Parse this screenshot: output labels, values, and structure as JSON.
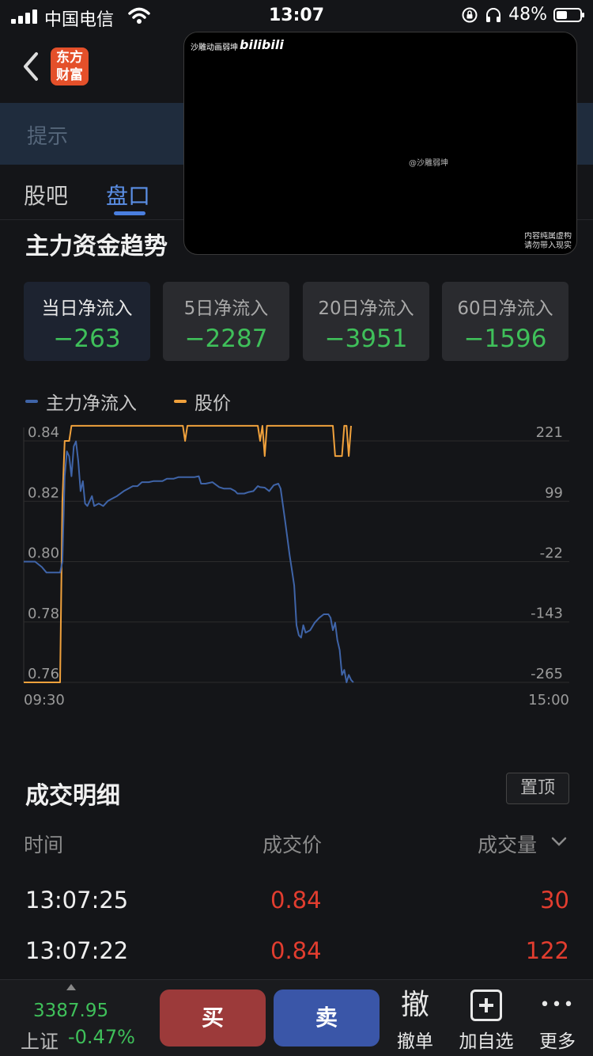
{
  "status_bar": {
    "carrier": "中国电信",
    "time": "13:07",
    "battery": "48%",
    "battery_level": 0.48
  },
  "header": {
    "logo_line1": "东方",
    "logo_line2": "财富",
    "tip": "提示"
  },
  "tabs": [
    {
      "label": "股吧"
    },
    {
      "label": "盘口",
      "active": true
    }
  ],
  "video": {
    "title": "沙雕动画弱坤",
    "logo": "bilibili",
    "watermark": "@沙雕弱坤",
    "note": "内容纯属虚构 请勿带入现实"
  },
  "section_title": "主力资金趋势",
  "flow_cards": [
    {
      "label": "当日净流入",
      "value": "−263"
    },
    {
      "label": "5日净流入",
      "value": "−2287"
    },
    {
      "label": "20日净流入",
      "value": "−3951"
    },
    {
      "label": "60日净流入",
      "value": "−1596"
    }
  ],
  "legend": {
    "flow": "主力净流入",
    "price": "股价"
  },
  "colors": {
    "flow": "#3f64a8",
    "price": "#f0a13c",
    "up": "#e23d2f",
    "down": "#3fc05a"
  },
  "chart_data": {
    "type": "line",
    "x_start": "09:30",
    "x_end": "15:00",
    "y_left_ticks": [
      "0.84",
      "0.82",
      "0.80",
      "0.78",
      "0.76"
    ],
    "y_right_ticks": [
      "221",
      "99",
      "-22",
      "-143",
      "-265"
    ],
    "ylim_left": [
      0.76,
      0.84
    ],
    "ylim_right": [
      -265,
      221
    ],
    "x_range_minutes": [
      0,
      240
    ],
    "series": [
      {
        "name": "股价",
        "axis": "left",
        "points": [
          [
            0,
            0.76
          ],
          [
            16,
            0.76
          ],
          [
            17,
            0.82
          ],
          [
            18,
            0.84
          ],
          [
            20,
            0.84
          ],
          [
            21,
            0.845
          ],
          [
            70,
            0.845
          ],
          [
            71,
            0.84
          ],
          [
            72,
            0.845
          ],
          [
            103,
            0.845
          ],
          [
            104,
            0.84
          ],
          [
            105,
            0.845
          ],
          [
            106,
            0.835
          ],
          [
            107,
            0.845
          ],
          [
            108,
            0.845
          ],
          [
            120,
            0.845
          ],
          [
            136,
            0.845
          ],
          [
            137,
            0.835
          ],
          [
            140,
            0.835
          ],
          [
            141,
            0.845
          ],
          [
            142,
            0.845
          ],
          [
            143,
            0.835
          ],
          [
            144,
            0.845
          ]
        ]
      },
      {
        "name": "主力净流入",
        "axis": "right",
        "points": [
          [
            0,
            -22
          ],
          [
            5,
            -22
          ],
          [
            8,
            -33
          ],
          [
            10,
            -44
          ],
          [
            16,
            -44
          ],
          [
            17,
            -22
          ],
          [
            18,
            150
          ],
          [
            19,
            200
          ],
          [
            20,
            190
          ],
          [
            21,
            150
          ],
          [
            22,
            210
          ],
          [
            23,
            220
          ],
          [
            24,
            180
          ],
          [
            25,
            120
          ],
          [
            26,
            140
          ],
          [
            27,
            95
          ],
          [
            28,
            90
          ],
          [
            30,
            110
          ],
          [
            31,
            90
          ],
          [
            33,
            95
          ],
          [
            35,
            90
          ],
          [
            37,
            100
          ],
          [
            39,
            105
          ],
          [
            41,
            110
          ],
          [
            44,
            120
          ],
          [
            46,
            125
          ],
          [
            48,
            130
          ],
          [
            50,
            130
          ],
          [
            52,
            138
          ],
          [
            55,
            138
          ],
          [
            57,
            140
          ],
          [
            61,
            140
          ],
          [
            63,
            145
          ],
          [
            66,
            145
          ],
          [
            68,
            148
          ],
          [
            71,
            148
          ],
          [
            73,
            148
          ],
          [
            75,
            148
          ],
          [
            77,
            150
          ],
          [
            78,
            135
          ],
          [
            80,
            135
          ],
          [
            83,
            138
          ],
          [
            86,
            128
          ],
          [
            88,
            125
          ],
          [
            91,
            125
          ],
          [
            93,
            120
          ],
          [
            94,
            115
          ],
          [
            97,
            115
          ],
          [
            99,
            118
          ],
          [
            101,
            120
          ],
          [
            103,
            130
          ],
          [
            104,
            128
          ],
          [
            106,
            127
          ],
          [
            108,
            120
          ],
          [
            110,
            132
          ],
          [
            112,
            135
          ],
          [
            113,
            125
          ],
          [
            115,
            60
          ],
          [
            117,
            -10
          ],
          [
            118,
            -40
          ],
          [
            119,
            -70
          ],
          [
            120,
            -150
          ],
          [
            121,
            -170
          ],
          [
            122,
            -175
          ],
          [
            123,
            -150
          ],
          [
            124,
            -165
          ],
          [
            126,
            -160
          ],
          [
            128,
            -145
          ],
          [
            130,
            -135
          ],
          [
            132,
            -128
          ],
          [
            134,
            -128
          ],
          [
            135,
            -135
          ],
          [
            136,
            -160
          ],
          [
            137,
            -145
          ],
          [
            138,
            -180
          ],
          [
            139,
            -200
          ],
          [
            140,
            -250
          ],
          [
            141,
            -240
          ],
          [
            142,
            -265
          ],
          [
            143,
            -250
          ],
          [
            144,
            -260
          ],
          [
            145,
            -265
          ]
        ]
      }
    ]
  },
  "trade_detail": {
    "title": "成交明细",
    "pin_button": "置顶",
    "columns": {
      "time": "时间",
      "price": "成交价",
      "volume": "成交量"
    },
    "rows": [
      {
        "time": "13:07:25",
        "price": "0.84",
        "volume": "30"
      },
      {
        "time": "13:07:22",
        "price": "0.84",
        "volume": "122"
      }
    ]
  },
  "bottom_bar": {
    "index_value": "3387.95",
    "index_name": "上证",
    "index_change": "-0.47%",
    "buy": "买",
    "sell": "卖",
    "tools": [
      {
        "glyph": "撤",
        "label": "撤单"
      },
      {
        "glyph": "",
        "label": "加自选"
      },
      {
        "glyph": "•••",
        "label": "更多"
      }
    ]
  }
}
